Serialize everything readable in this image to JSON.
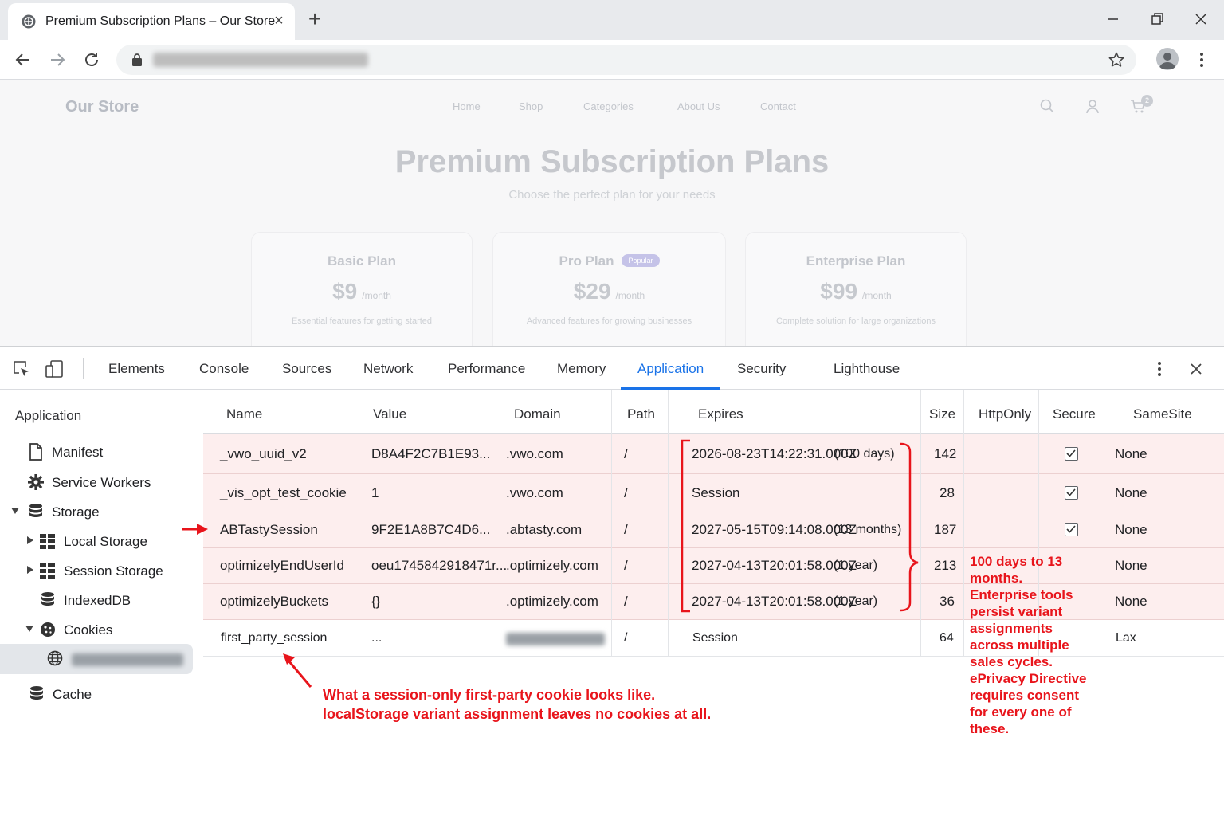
{
  "browser": {
    "tab_title": "Premium Subscription Plans – Our Store",
    "new_tab": "+"
  },
  "site": {
    "brand": "Our Store",
    "nav": [
      "Home",
      "Shop",
      "Categories",
      "About Us",
      "Contact"
    ],
    "cart_count": "2",
    "hero_title": "Premium Subscription Plans",
    "hero_subtitle": "Choose the perfect plan for your needs",
    "plans": [
      {
        "name": "Basic Plan",
        "price": "$9",
        "period": "/month",
        "desc": "Essential features for getting started",
        "badge": ""
      },
      {
        "name": "Pro Plan",
        "price": "$29",
        "period": "/month",
        "desc": "Advanced features for growing businesses",
        "badge": "Popular"
      },
      {
        "name": "Enterprise Plan",
        "price": "$99",
        "period": "/month",
        "desc": "Complete solution for large organizations",
        "badge": ""
      }
    ]
  },
  "devtools": {
    "tabs": [
      "Elements",
      "Console",
      "Sources",
      "Network",
      "Performance",
      "Memory",
      "Application",
      "Security",
      "Lighthouse"
    ],
    "active_tab": "Application",
    "sidebar": {
      "heading": "Application",
      "items": [
        "Manifest",
        "Service Workers",
        "Storage",
        "Local Storage",
        "Session Storage",
        "IndexedDB",
        "Cookies",
        "Cache"
      ]
    },
    "columns": [
      "Name",
      "Value",
      "Domain",
      "Path",
      "Expires",
      "Size",
      "HttpOnly",
      "Secure",
      "SameSite"
    ],
    "cookies": [
      {
        "name": "_vwo_uuid_v2",
        "value": "D8A4F2C7B1E93...",
        "domain": ".vwo.com",
        "path": "/",
        "expires": "2026-08-23T14:22:31.000Z",
        "expires_note": "(100 days)",
        "size": "142",
        "httponly": false,
        "secure": true,
        "samesite": "None"
      },
      {
        "name": "_vis_opt_test_cookie",
        "value": "1",
        "domain": ".vwo.com",
        "path": "/",
        "expires": "Session",
        "expires_note": "",
        "size": "28",
        "httponly": false,
        "secure": true,
        "samesite": "None"
      },
      {
        "name": "ABTastySession",
        "value": "9F2E1A8B7C4D6...",
        "domain": ".abtasty.com",
        "path": "/",
        "expires": "2027-05-15T09:14:08.000Z",
        "expires_note": "(13 months)",
        "size": "187",
        "httponly": false,
        "secure": true,
        "samesite": "None"
      },
      {
        "name": "optimizelyEndUserId",
        "value": "oeu1745842918471r...",
        "domain": ".optimizely.com",
        "path": "/",
        "expires": "2027-04-13T20:01:58.000Z",
        "expires_note": "(1 year)",
        "size": "213",
        "httponly": false,
        "secure": false,
        "samesite": "None"
      },
      {
        "name": "optimizelyBuckets",
        "value": "{}",
        "domain": ".optimizely.com",
        "path": "/",
        "expires": "2027-04-13T20:01:58.000Z",
        "expires_note": "(1 year)",
        "size": "36",
        "httponly": false,
        "secure": false,
        "samesite": "None"
      },
      {
        "name": "first_party_session",
        "value": "...",
        "domain": "",
        "path": "/",
        "expires": "Session",
        "expires_note": "",
        "size": "64",
        "httponly": false,
        "secure": false,
        "samesite": "Lax"
      }
    ]
  },
  "annotations": {
    "bottom_line1": "What a session-only first-party cookie looks like.",
    "bottom_line2": "localStorage variant assignment leaves no cookies at all.",
    "side_note": "100 days to 13 months. Enterprise tools persist variant assignments across multiple sales cycles. ePrivacy Directive requires consent for every one of these."
  },
  "colors": {
    "accent": "#1a73e8",
    "annotation": "#e8141b",
    "row_highlight": "#fdeeee"
  }
}
